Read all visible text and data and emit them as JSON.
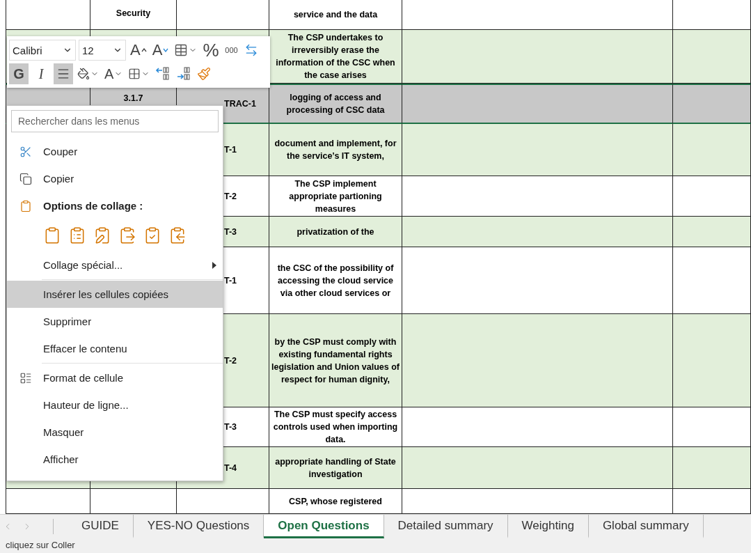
{
  "sheet": {
    "rows": [
      {
        "shaded": false,
        "selected": false,
        "cells": [
          "",
          "Security",
          "",
          "service and the data",
          "",
          ""
        ]
      },
      {
        "shaded": true,
        "selected": false,
        "cells": [
          "",
          "",
          "",
          "The CSP undertakes to irreversibly erase the information of the CSC when the case arises",
          "",
          ""
        ]
      },
      {
        "shaded": false,
        "selected": true,
        "cells": [
          "",
          "3.1.7",
          "TRAC-1",
          "logging of access and processing of CSC data",
          "",
          ""
        ]
      },
      {
        "shaded": true,
        "selected": false,
        "cells": [
          "",
          "",
          "T-1",
          "document and implement, for the service’s IT system,",
          "",
          ""
        ]
      },
      {
        "shaded": false,
        "selected": false,
        "cells": [
          "",
          "",
          "T-2",
          "The CSP implement appropriate partioning measures",
          "",
          ""
        ]
      },
      {
        "shaded": true,
        "selected": false,
        "cells": [
          "",
          "",
          "T-3",
          "privatization of the",
          "",
          ""
        ]
      },
      {
        "shaded": false,
        "selected": false,
        "cells": [
          "",
          "",
          "T-1",
          "the CSC of the possibility of accessing the cloud service via other cloud services or",
          "",
          ""
        ]
      },
      {
        "shaded": true,
        "selected": false,
        "cells": [
          "",
          "",
          "T-2",
          "by the CSP must comply with existing fundamental rights legislation and Union values of respect for human dignity,",
          "",
          ""
        ]
      },
      {
        "shaded": false,
        "selected": false,
        "cells": [
          "",
          "",
          "T-3",
          "The CSP must specify access controls used when importing data.",
          "",
          ""
        ]
      },
      {
        "shaded": true,
        "selected": false,
        "cells": [
          "",
          "",
          "T-4",
          "appropriate handling of State investigation",
          "",
          ""
        ]
      },
      {
        "shaded": false,
        "selected": false,
        "cells": [
          "",
          "",
          "",
          "CSP, whose registered",
          "",
          ""
        ]
      }
    ]
  },
  "mini_toolbar": {
    "font": "Calibri",
    "size": "12",
    "row_1": [
      {
        "kind": "grow",
        "label": "A"
      },
      {
        "kind": "shrink",
        "label": "A"
      },
      {
        "kind": "format"
      },
      {
        "kind": "percent",
        "label": "%"
      },
      {
        "kind": "thousands",
        "label": "000"
      },
      {
        "kind": "merge"
      }
    ],
    "row_2": [
      {
        "kind": "bold",
        "label": "G",
        "selected": true
      },
      {
        "kind": "italic",
        "label": "I",
        "selected": false
      },
      {
        "kind": "align",
        "selected": true
      },
      {
        "kind": "fill"
      },
      {
        "kind": "font-color",
        "label": "A"
      },
      {
        "kind": "border"
      },
      {
        "kind": "increase-decimals"
      },
      {
        "kind": "decrease-decimals"
      },
      {
        "kind": "painter"
      }
    ]
  },
  "context_menu": {
    "search": {
      "placeholder": "Rechercher dans les menus"
    },
    "items": [
      {
        "kind": "cut",
        "label": "Couper",
        "selected": false
      },
      {
        "kind": "copy",
        "label": "Copier",
        "selected": false
      },
      {
        "kind": "paste-header",
        "label": "Options de collage :",
        "selected": false
      },
      {
        "kind": "paste-options"
      },
      {
        "kind": "submenu",
        "label": "Collage spécial...",
        "selected": false
      },
      {
        "kind": "separator"
      },
      {
        "kind": "command",
        "label": "Insérer les cellules copiées",
        "selected": true
      },
      {
        "kind": "command",
        "label": "Supprimer",
        "selected": false
      },
      {
        "kind": "command",
        "label": "Effacer le contenu",
        "selected": false
      },
      {
        "kind": "separator"
      },
      {
        "kind": "format-cells",
        "label": "Format de cellule",
        "selected": false
      },
      {
        "kind": "command",
        "label": "Hauteur de ligne...",
        "selected": false
      },
      {
        "kind": "command",
        "label": "Masquer",
        "selected": false
      },
      {
        "kind": "command",
        "label": "Afficher",
        "selected": false
      }
    ]
  },
  "sheet_tabs": [
    {
      "label": "GUIDE",
      "selected": false
    },
    {
      "label": "YES-NO Questions",
      "selected": false
    },
    {
      "label": "Open Questions",
      "selected": true
    },
    {
      "label": "Detailed summary",
      "selected": false
    },
    {
      "label": "Weighting",
      "selected": false
    },
    {
      "label": "Global summary",
      "selected": false
    }
  ],
  "status_bar": "cliquez sur Coller"
}
